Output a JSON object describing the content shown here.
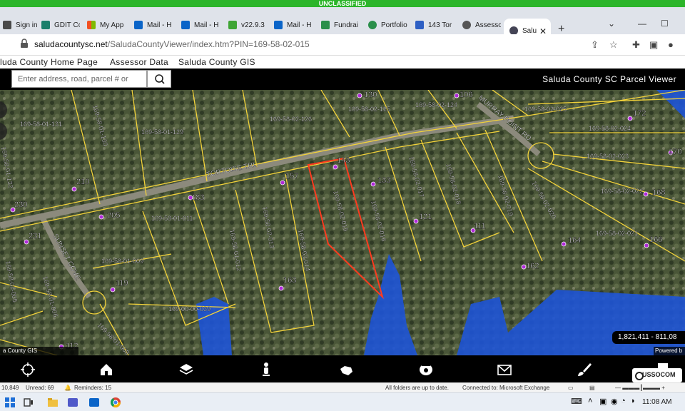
{
  "banner": "UNCLASSIFIED",
  "tabs": [
    {
      "label": "Sign in"
    },
    {
      "label": "GDIT Co"
    },
    {
      "label": "My App"
    },
    {
      "label": "Mail - H"
    },
    {
      "label": "Mail - H"
    },
    {
      "label": "v22.9.3"
    },
    {
      "label": "Mail - H"
    },
    {
      "label": "Fundrai"
    },
    {
      "label": "Portfolio"
    },
    {
      "label": "143 Tor"
    },
    {
      "label": "Assesso"
    },
    {
      "label": "Salu"
    }
  ],
  "new_tab": "+",
  "window": {
    "minimize": "⌄",
    "min": "—",
    "max": "☐"
  },
  "url": {
    "host": "saludacountysc.net",
    "path": "/SaludaCountyViewer/index.htm?PIN=169-58-02-015"
  },
  "nav_links": [
    "luda County Home Page",
    "Assessor Data",
    "Saluda County GIS"
  ],
  "search": {
    "placeholder": "Enter address, road, parcel # or"
  },
  "app_title": "Saluda County SC Parcel Viewer",
  "roads": {
    "tortoise": "TORTOISE TRL",
    "sunset": "SUNSET COVE",
    "murray": "MURRAY POINT RD"
  },
  "parcels": [
    "169-58-01-131",
    "169-58-01-130",
    "169-58-01-129",
    "169-58-02-126",
    "169-58-02-125",
    "169-58-02-124",
    "169-58-02-025",
    "169-58-02-024",
    "169-58-02-023",
    "169-58-02-022",
    "169-58-02-021",
    "169-58-01-011",
    "169-58-01-009",
    "169-58-01-012",
    "169-58-02-013",
    "169-58-02-014",
    "169-58-02-015",
    "169-58-02-016",
    "169-58-02-017",
    "169-58-02-018",
    "169-58-02-019",
    "169-58-02-020",
    "169-58-01-006",
    "169-58-01-005",
    "169-00-00-039",
    "169-58-01-008",
    "169-58-01-132"
  ],
  "addresses": [
    "130",
    "106",
    "172",
    "170",
    "143",
    "157",
    "133",
    "210",
    "183",
    "230",
    "205",
    "121",
    "111",
    "168",
    "164",
    "166",
    "162",
    "231",
    "119",
    "163",
    "112"
  ],
  "coordinates": "1,821,411 - 811,08",
  "credits": {
    "left": "a County GIS",
    "right": "Powered b"
  },
  "tools": [
    "target-icon",
    "home-icon",
    "layers-icon",
    "person-icon",
    "hand-icon",
    "measure-icon",
    "mail-icon",
    "brush-icon"
  ],
  "logo": "USSOCOM",
  "status": {
    "items": "10,849",
    "unread": "Unread: 69",
    "reminders": "Reminders: 15",
    "folders": "All folders are up to date.",
    "connected": "Connected to: Microsoft Exchange"
  },
  "clock": "11:08 AM",
  "colors": {
    "banner": "#2cb52a",
    "parcel_line": "#f2d23a",
    "selected_parcel": "#ff3b1f",
    "water": "#1e54d6",
    "address_dot": "#b02ad8"
  }
}
